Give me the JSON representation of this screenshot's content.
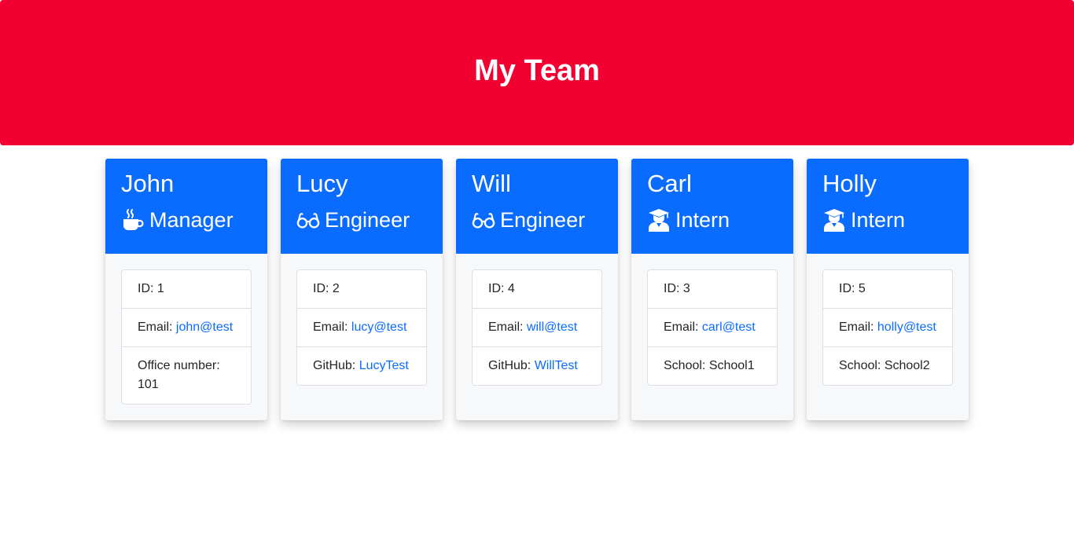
{
  "header": {
    "title": "My Team"
  },
  "cards": [
    {
      "name": "John",
      "role": "Manager",
      "role_icon": "coffee-mug-icon",
      "id_label": "ID: ",
      "id_value": "1",
      "email_label": "Email: ",
      "email_value": "john@test",
      "extra_label": "Office number: ",
      "extra_value": "101"
    },
    {
      "name": "Lucy",
      "role": "Engineer",
      "role_icon": "glasses-icon",
      "id_label": "ID: ",
      "id_value": "2",
      "email_label": "Email: ",
      "email_value": "lucy@test",
      "extra_label": "GitHub: ",
      "extra_value": "LucyTest"
    },
    {
      "name": "Will",
      "role": "Engineer",
      "role_icon": "glasses-icon",
      "id_label": "ID: ",
      "id_value": "4",
      "email_label": "Email: ",
      "email_value": "will@test",
      "extra_label": "GitHub: ",
      "extra_value": "WillTest"
    },
    {
      "name": "Carl",
      "role": "Intern",
      "role_icon": "graduate-icon",
      "id_label": "ID: ",
      "id_value": "3",
      "email_label": "Email: ",
      "email_value": "carl@test",
      "extra_label": "School: ",
      "extra_value": "School1"
    },
    {
      "name": "Holly",
      "role": "Intern",
      "role_icon": "graduate-icon",
      "id_label": "ID: ",
      "id_value": "5",
      "email_label": "Email: ",
      "email_value": "holly@test",
      "extra_label": "School: ",
      "extra_value": "School2"
    }
  ],
  "colors": {
    "header_bg": "#f20031",
    "card_header_bg": "#0a6cff",
    "link": "#0a6cff"
  }
}
